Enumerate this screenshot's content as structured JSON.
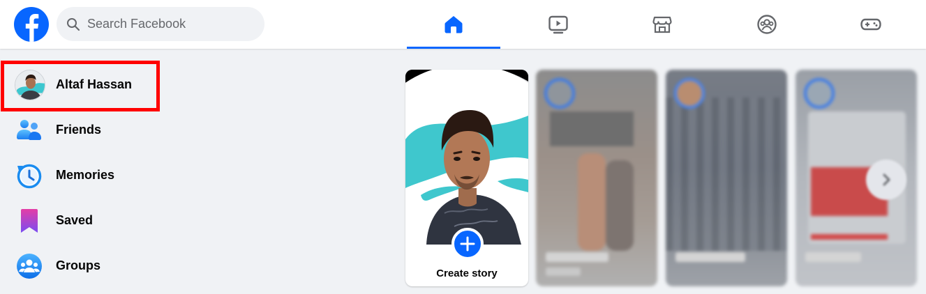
{
  "header": {
    "search_placeholder": "Search Facebook",
    "logo_icon": "facebook-logo-icon",
    "tabs": [
      {
        "name": "home",
        "icon": "home-icon",
        "active": true
      },
      {
        "name": "video",
        "icon": "video-icon",
        "active": false
      },
      {
        "name": "marketplace",
        "icon": "marketplace-icon",
        "active": false
      },
      {
        "name": "groups",
        "icon": "groups-icon",
        "active": false
      },
      {
        "name": "gaming",
        "icon": "gaming-icon",
        "active": false
      }
    ]
  },
  "sidebar": {
    "profile_name": "Altaf Hassan",
    "items": [
      {
        "label": "Friends",
        "icon": "friends-icon"
      },
      {
        "label": "Memories",
        "icon": "memories-icon"
      },
      {
        "label": "Saved",
        "icon": "saved-icon"
      },
      {
        "label": "Groups",
        "icon": "groups-icon"
      }
    ]
  },
  "stories": {
    "create_label": "Create story",
    "create_icon": "plus-icon",
    "next_icon": "chevron-right-icon"
  },
  "colors": {
    "brand": "#0866ff",
    "highlight": "#ff0000",
    "background": "#f0f2f5"
  }
}
